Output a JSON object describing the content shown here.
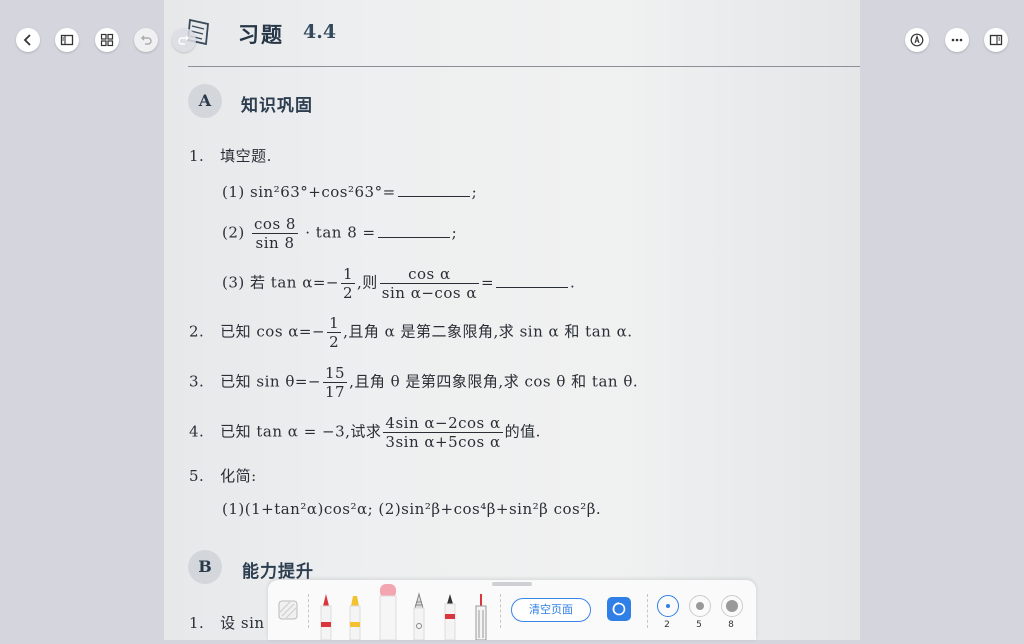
{
  "header": {
    "title": "习题",
    "number": "4.4"
  },
  "sectionA": {
    "badge": "A",
    "title": "知识巩固"
  },
  "sectionB": {
    "badge": "B",
    "title": "能力提升"
  },
  "problems": {
    "p1": {
      "num": "1.",
      "text": "填空题."
    },
    "p1_1": {
      "label": "(1)",
      "expr": "sin²63°+cos²63°=",
      "end": ";"
    },
    "p1_2": {
      "label": "(2)",
      "num": "cos 8",
      "den": "sin 8",
      "tail": "· tan 8 =",
      "end": ";"
    },
    "p1_3": {
      "label": "(3)",
      "pre": "若 tan α=−",
      "fnum": "1",
      "fden": "2",
      "mid": ",则",
      "num2": "cos α",
      "den2": "sin α−cos α",
      "eq": "=",
      "end": "."
    },
    "p2": {
      "num": "2.",
      "pre": "已知 cos α=−",
      "fnum": "1",
      "fden": "2",
      "post": ",且角 α 是第二象限角,求 sin α 和 tan α."
    },
    "p3": {
      "num": "3.",
      "pre": "已知 sin θ=−",
      "fnum": "15",
      "fden": "17",
      "post": ",且角 θ 是第四象限角,求 cos θ 和 tan θ."
    },
    "p4": {
      "num": "4.",
      "pre": "已知 tan α = −3,试求",
      "fnum": "4sin α−2cos α",
      "fden": "3sin α+5cos α",
      "post": "的值."
    },
    "p5": {
      "num": "5.",
      "text": "化简:"
    },
    "p5_sub": {
      "text": "(1)(1+tan²α)cos²α;  (2)sin²β+cos⁴β+sin²β cos²β."
    },
    "b1": {
      "num": "1.",
      "text": "设 sin"
    }
  },
  "toolbar": {
    "clear_label": "清空页面",
    "sizes": [
      "2",
      "5",
      "8"
    ],
    "colors": {
      "red": "#d9363e",
      "yellow": "#f2c230",
      "pink": "#f4a6b0",
      "accent": "#2f7fe6"
    }
  },
  "icons": {
    "nav": [
      "back-icon",
      "sidebar-icon",
      "grid-icon",
      "undo-icon",
      "redo-icon"
    ],
    "right": [
      "pen-mode-icon",
      "more-icon",
      "reader-icon"
    ]
  }
}
